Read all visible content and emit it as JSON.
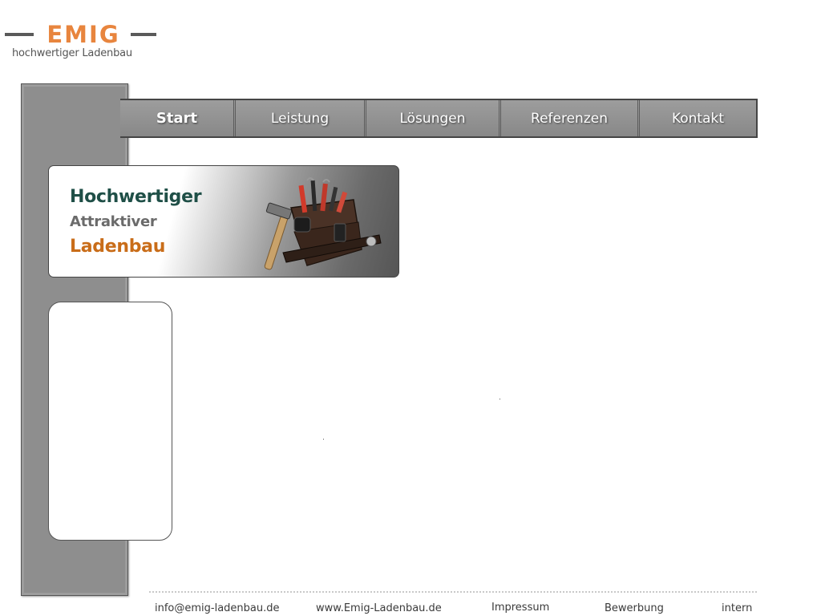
{
  "logo": {
    "word": "EMIG",
    "tagline": "hochwertiger Ladenbau",
    "accent_color": "#e8853e"
  },
  "nav": {
    "items": [
      {
        "label": "Start",
        "active": true
      },
      {
        "label": "Leistung",
        "active": false
      },
      {
        "label": "Lösungen",
        "active": false
      },
      {
        "label": "Referenzen",
        "active": false
      },
      {
        "label": "Kontakt",
        "active": false
      }
    ]
  },
  "banner": {
    "line1": "Hochwertiger",
    "line2": "Attraktiver",
    "line3": "Ladenbau",
    "image_icon": "tool-belt-icon",
    "colors": {
      "line1": "#1f4f47",
      "line2": "#6b6b6b",
      "line3": "#c96d19"
    }
  },
  "footer": {
    "links": [
      "info@emig-ladenbau.de",
      "www.Emig-Ladenbau.de",
      "Impressum",
      "Bewerbung",
      "intern"
    ]
  }
}
